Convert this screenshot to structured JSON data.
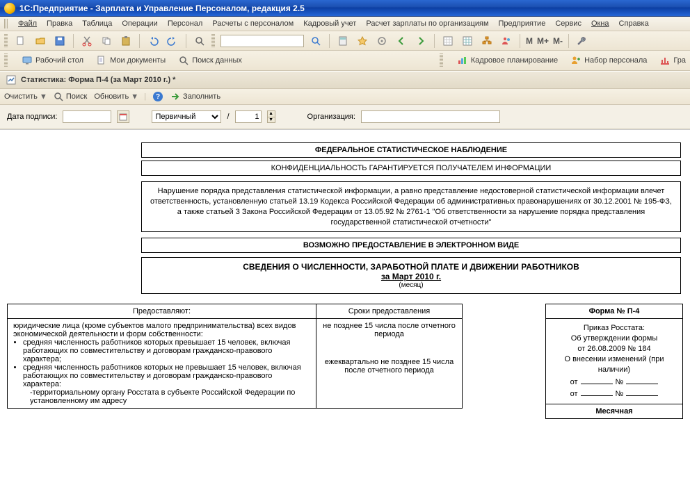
{
  "app": {
    "title": "1C:Предприятие - Зарплата и Управление Персоналом, редакция 2.5"
  },
  "menu": {
    "file": "Файл",
    "edit": "Правка",
    "table": "Таблица",
    "operations": "Операции",
    "personnel": "Персонал",
    "calc": "Расчеты с персоналом",
    "hr": "Кадровый учет",
    "payroll": "Расчет зарплаты по организациям",
    "enterprise": "Предприятие",
    "service": "Сервис",
    "windows": "Окна",
    "help": "Справка"
  },
  "toolbar": {
    "zoom_m": "M",
    "zoom_mplus": "M+",
    "zoom_mminus": "M-"
  },
  "tabs": {
    "desktop": "Рабочий стол",
    "docs": "Мои документы",
    "find": "Поиск данных",
    "planning": "Кадровое планирование",
    "recruit": "Набор персонала",
    "chart": "Гра"
  },
  "window": {
    "title": "Статистика: Форма П-4 (за Март 2010 г.) *"
  },
  "actions": {
    "clear": "Очистить",
    "search": "Поиск",
    "refresh": "Обновить",
    "fill": "Заполнить"
  },
  "params": {
    "date_label": "Дата подписи:",
    "date_value": "",
    "kind": "Первичный",
    "slash": "/",
    "number": "1",
    "org_label": "Организация:",
    "org_value": ""
  },
  "doc": {
    "box1": "ФЕДЕРАЛЬНОЕ СТАТИСТИЧЕСКОЕ НАБЛЮДЕНИЕ",
    "box2": "КОНФИДЕНЦИАЛЬНОСТЬ ГАРАНТИРУЕТСЯ ПОЛУЧАТЕЛЕМ ИНФОРМАЦИИ",
    "law": "Нарушение порядка представления статистической информации, а равно представление недостоверной статистической информации влечет ответственность, установленную статьей 13.19 Кодекса Российской Федерации об административных правонарушениях от 30.12.2001 № 195-ФЗ, а также статьей 3 Закона Российской Федерации от 13.05.92 № 2761-1 \"Об ответственности за нарушение порядка представления государственной статистической отчетности\"",
    "box3": "ВОЗМОЖНО ПРЕДОСТАВЛЕНИЕ В ЭЛЕКТРОННОМ ВИДЕ",
    "title": "СВЕДЕНИЯ О ЧИСЛЕННОСТИ, ЗАРАБОТНОЙ ПЛАТЕ И ДВИЖЕНИИ РАБОТНИКОВ",
    "period": "за Март 2010 г.",
    "period_sub": "(месяц)",
    "table": {
      "h_provide": "Предоставляют:",
      "h_due": "Сроки предоставления",
      "provide_intro": "юридические лица (кроме субъектов малого предпринимательства) всех видов экономической деятельности и форм собственности:",
      "provide_b1": "средняя численность работников которых превышает 15 человек, включая работающих по совместительству и договорам гражданско-правового характера;",
      "provide_b2": "средняя численность работников которых не превышает 15 человек, включая работающих по совместительству и договорам гражданско-правового характера:",
      "provide_sub": "-территориальному органу Росстата в субъекте Российской Федерации по установленному им адресу",
      "due_1": "не позднее 15 числа после отчетного периода",
      "due_2": "ежеквартально не позднее 15 числа после отчетного периода"
    },
    "right": {
      "header": "Форма № П-4",
      "l1": "Приказ Росстата:",
      "l2": "Об утверждении формы",
      "l3": "от 26.08.2009 № 184",
      "l4": "О внесении изменений (при наличии)",
      "from": "от",
      "no": "№",
      "footer": "Месячная"
    }
  }
}
